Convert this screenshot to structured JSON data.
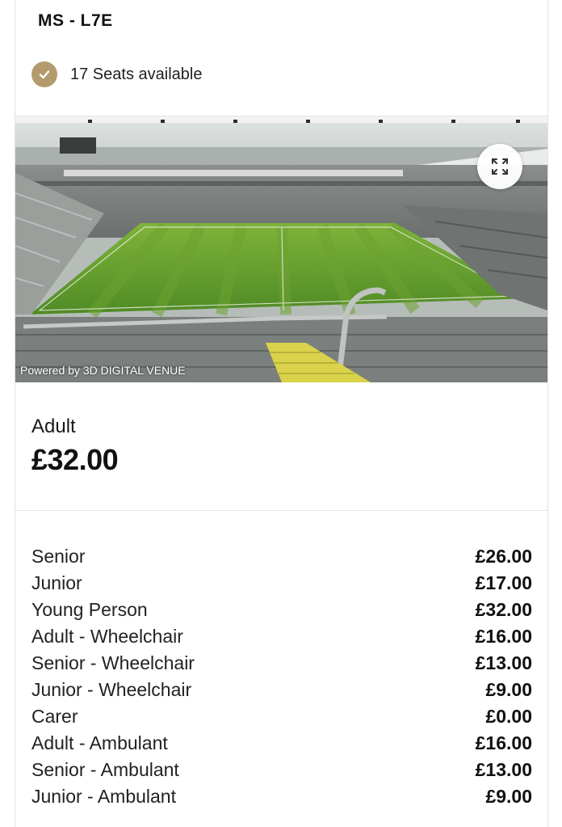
{
  "seat": {
    "title": "MS - L7E"
  },
  "availability": {
    "text": "17 Seats available",
    "badge_color": "#b39b6e",
    "icon": "check-icon"
  },
  "venue_view": {
    "credit": "Powered by 3D DIGITAL VENUE",
    "expand_icon": "expand-icon"
  },
  "adult": {
    "label": "Adult",
    "price": "£32.00"
  },
  "prices": [
    {
      "name": "Senior",
      "price": "£26.00"
    },
    {
      "name": "Junior",
      "price": "£17.00"
    },
    {
      "name": "Young Person",
      "price": "£32.00"
    },
    {
      "name": "Adult - Wheelchair",
      "price": "£16.00"
    },
    {
      "name": "Senior - Wheelchair",
      "price": "£13.00"
    },
    {
      "name": "Junior - Wheelchair",
      "price": "£9.00"
    },
    {
      "name": "Carer",
      "price": "£0.00"
    },
    {
      "name": "Adult - Ambulant",
      "price": "£16.00"
    },
    {
      "name": "Senior - Ambulant",
      "price": "£13.00"
    },
    {
      "name": "Junior - Ambulant",
      "price": "£9.00"
    }
  ]
}
